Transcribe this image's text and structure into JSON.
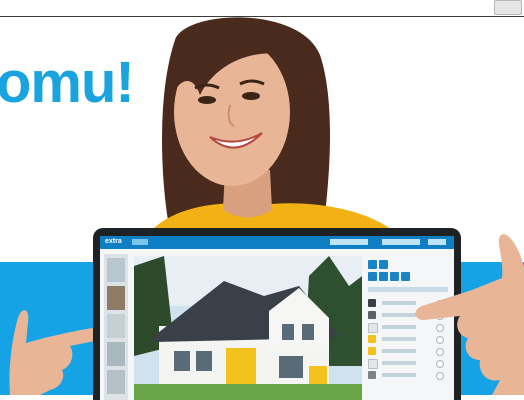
{
  "headline": {
    "text": "omu!"
  },
  "colors": {
    "accent": "#19a4e0",
    "band": "#15a3e6",
    "app_header": "#0d7fc2",
    "sweater": "#f2b114",
    "hair": "#4a2a1c",
    "skin": "#e8b596"
  },
  "app": {
    "logo": "extra",
    "icons": [
      "pencil-icon",
      "save-icon",
      "share-icon",
      "print-icon",
      "settings-icon",
      "help-icon"
    ],
    "swatches": [
      {
        "color": "#3a3f46"
      },
      {
        "color": "#5b6168"
      },
      {
        "color": "#e2e5e8"
      },
      {
        "color": "#f3c21c"
      },
      {
        "color": "#f3c21c"
      },
      {
        "color": "#e3e5e6"
      },
      {
        "color": "#7b8288"
      }
    ]
  }
}
